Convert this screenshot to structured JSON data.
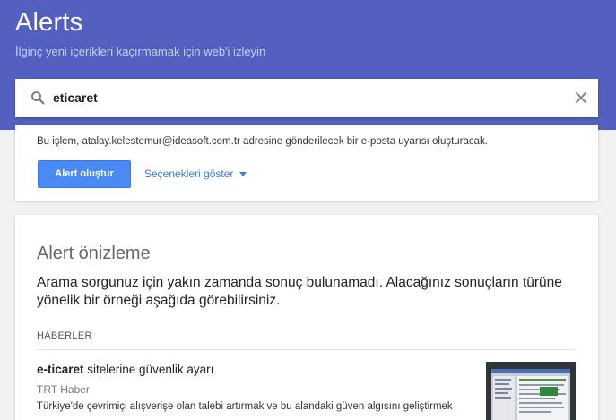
{
  "header": {
    "title": "Alerts",
    "subtitle": "İlginç yeni içerikleri kaçırmamak için web'i izleyin"
  },
  "search": {
    "value": "eticaret",
    "search_icon": "search-icon",
    "clear_icon": "close-icon"
  },
  "confirm": {
    "message": "Bu işlem, atalay.kelestemur@ideasoft.com.tr adresine gönderilecek bir e-posta uyarısı oluşturacak.",
    "create_label": "Alert oluştur",
    "options_label": "Seçenekleri göster"
  },
  "preview": {
    "title": "Alert önizleme",
    "message": "Arama sorgunuz için yakın zamanda sonuç bulunamadı. Alacağınız sonuçların türüne yönelik bir örneği aşağıda görebilirsiniz.",
    "section_label": "HABERLER",
    "news": {
      "title_bold": "e-ticaret",
      "title_rest": " sitelerine güvenlik ayarı",
      "source": "TRT Haber",
      "snippet": "Türkiye'de çevrimiçi alışverişe olan talebi artırmak ve bu alandaki güven algısını geliştirmek"
    }
  },
  "colors": {
    "header_bg": "#5360c0",
    "primary_button": "#4a8af4",
    "link": "#3d7be0"
  }
}
